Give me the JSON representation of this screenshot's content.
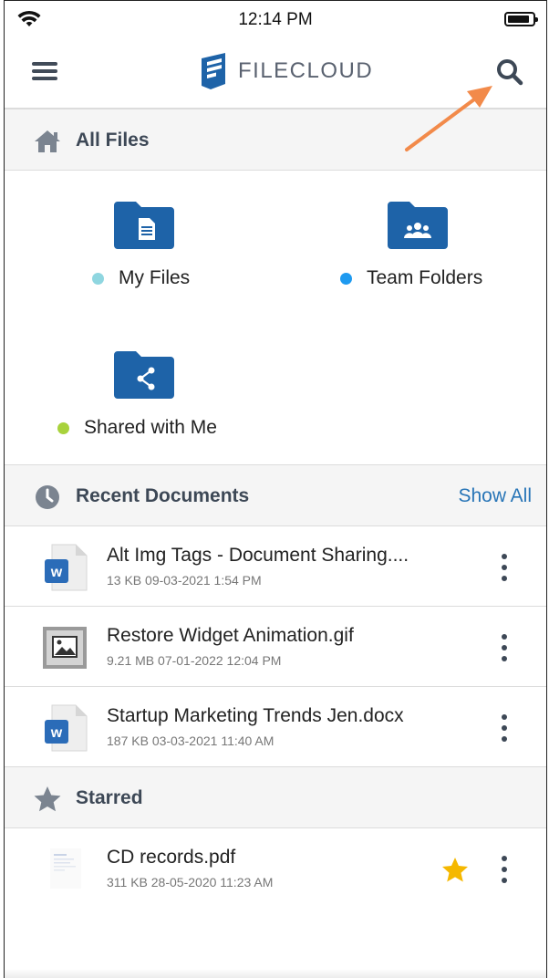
{
  "status_bar": {
    "time": "12:14 PM",
    "wifi_icon": "wifi-icon",
    "battery_icon": "battery-icon"
  },
  "header": {
    "menu_icon": "hamburger-menu-icon",
    "logo_text": "FILECLOUD",
    "search_icon": "search-icon",
    "annotation_arrow_color": "#f28a4a"
  },
  "all_files": {
    "title": "All Files",
    "icon": "home-icon",
    "folders": [
      {
        "label": "My Files",
        "icon": "folder-document-icon",
        "dot_color": "#8fd6e0"
      },
      {
        "label": "Team Folders",
        "icon": "folder-team-icon",
        "dot_color": "#1e9af0"
      },
      {
        "label": "Shared with Me",
        "icon": "folder-share-icon",
        "dot_color": "#a8d23c"
      }
    ]
  },
  "recent_documents": {
    "title": "Recent Documents",
    "icon": "clock-icon",
    "show_all_label": "Show All",
    "items": [
      {
        "name": "Alt Img Tags - Document Sharing....",
        "meta": "13 KB 09-03-2021 1:54 PM",
        "icon": "word-doc-icon"
      },
      {
        "name": "Restore Widget Animation.gif",
        "meta": "9.21 MB 07-01-2022 12:04 PM",
        "icon": "image-file-icon"
      },
      {
        "name": "Startup Marketing Trends Jen.docx",
        "meta": "187 KB 03-03-2021 11:40 AM",
        "icon": "word-doc-icon"
      }
    ]
  },
  "starred": {
    "title": "Starred",
    "icon": "star-icon",
    "items": [
      {
        "name": "CD records.pdf",
        "meta": "311 KB 28-05-2020 11:23 AM",
        "icon": "pdf-thumbnail-icon",
        "starred": true
      }
    ]
  },
  "colors": {
    "folder_blue": "#1e63a8",
    "accent_blue": "#2875b7",
    "header_text": "#3d4856",
    "star_yellow": "#f5b800"
  }
}
